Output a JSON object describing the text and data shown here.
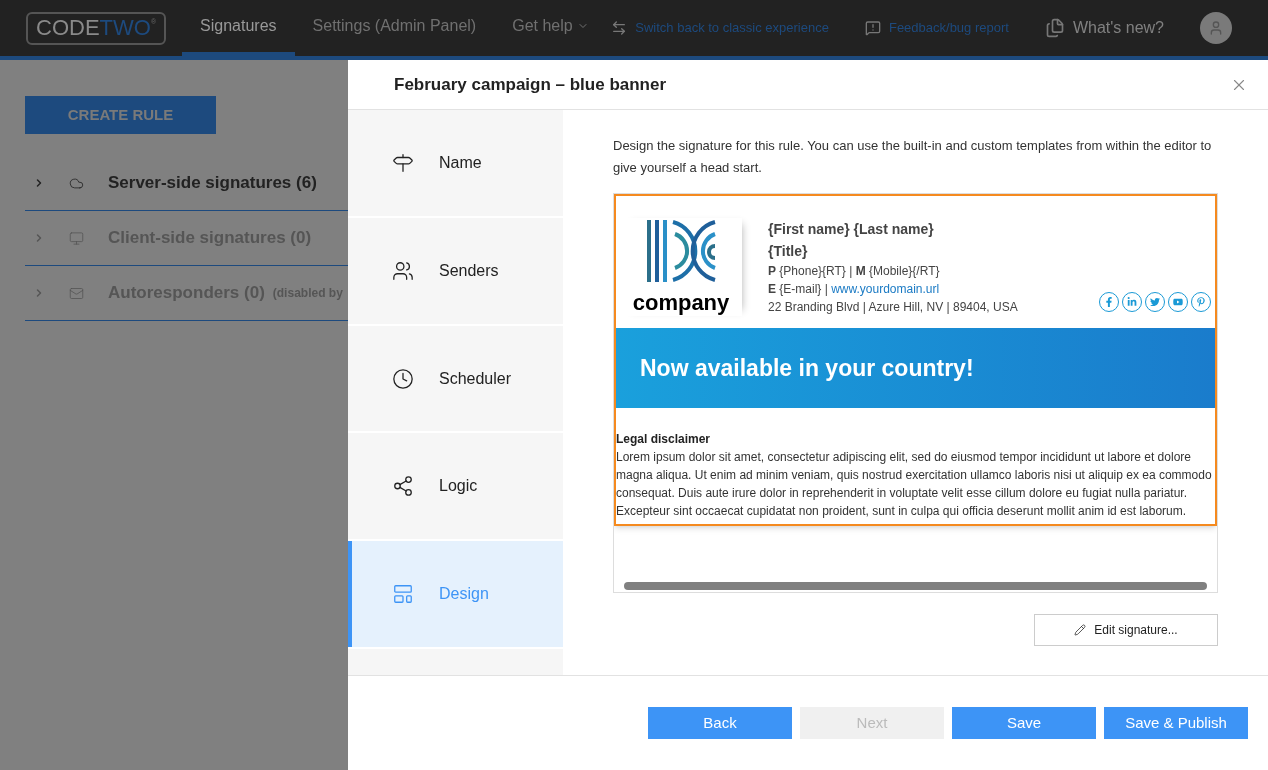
{
  "topbar": {
    "logo": {
      "part_1": "CODE",
      "part_2": "TWO",
      "mark": "®"
    },
    "tabs": [
      {
        "label": "Signatures",
        "selected": true
      },
      {
        "label": "Settings (Admin Panel)",
        "selected": false
      },
      {
        "label": "Get help",
        "selected": false,
        "dropdown": true
      }
    ],
    "links": [
      {
        "kind": "switch",
        "label": "Switch back to classic experience"
      },
      {
        "kind": "feedback",
        "label": "Feedback/bug report"
      },
      {
        "kind": "news",
        "label": "What's new?"
      }
    ]
  },
  "background": {
    "create_button": "CREATE RULE",
    "tree": [
      {
        "kind": "cloud",
        "label": "Server-side signatures (6)",
        "disabled": false
      },
      {
        "kind": "desktop",
        "label": "Client-side signatures (0)",
        "disabled": true
      },
      {
        "kind": "mail",
        "label": "Autoresponders (0)",
        "note": "(disabled by",
        "disabled": true
      }
    ]
  },
  "dialog": {
    "title": "February campaign – blue banner",
    "steps": [
      {
        "kind": "name",
        "label": "Name",
        "selected": false
      },
      {
        "kind": "senders",
        "label": "Senders",
        "selected": false
      },
      {
        "kind": "scheduler",
        "label": "Scheduler",
        "selected": false
      },
      {
        "kind": "logic",
        "label": "Logic",
        "selected": false
      },
      {
        "kind": "design",
        "label": "Design",
        "selected": true
      }
    ],
    "intro": "Design the signature for this rule. You can use the built-in and custom templates from within the editor to give yourself a head start.",
    "signature": {
      "company": "company",
      "name": "{First name} {Last name}",
      "title": "{Title}",
      "phone_line": "**P** {Phone}{RT} | **M** {Mobile}{/RT}",
      "email_line": "**E** {E-mail} | ",
      "website": "www.yourdomain.url",
      "address": "22 Branding Blvd | Azure Hill, NV | 89404, USA",
      "social": [
        {
          "kind": "facebook"
        },
        {
          "kind": "linkedin"
        },
        {
          "kind": "twitter"
        },
        {
          "kind": "youtube"
        },
        {
          "kind": "pinterest"
        }
      ],
      "banner": "Now available in your country!",
      "disclaimer_title": "Legal disclaimer",
      "disclaimer": "Lorem ipsum dolor sit amet, consectetur adipiscing elit, sed do eiusmod tempor incididunt ut labore et dolore magna aliqua. Ut enim ad minim veniam, quis nostrud exercitation ullamco laboris nisi ut aliquip ex ea commodo consequat. Duis aute irure dolor in reprehenderit in voluptate velit esse cillum dolore eu fugiat nulla pariatur. Excepteur sint occaecat cupidatat non proident, sunt in culpa qui officia deserunt mollit anim id est laborum."
    },
    "edit_button": "Edit signature...",
    "buttons": [
      {
        "label": "Back",
        "disabled": false
      },
      {
        "label": "Next",
        "disabled": true
      },
      {
        "label": "Save",
        "disabled": false
      },
      {
        "label": "Save & Publish",
        "disabled": false
      }
    ]
  }
}
